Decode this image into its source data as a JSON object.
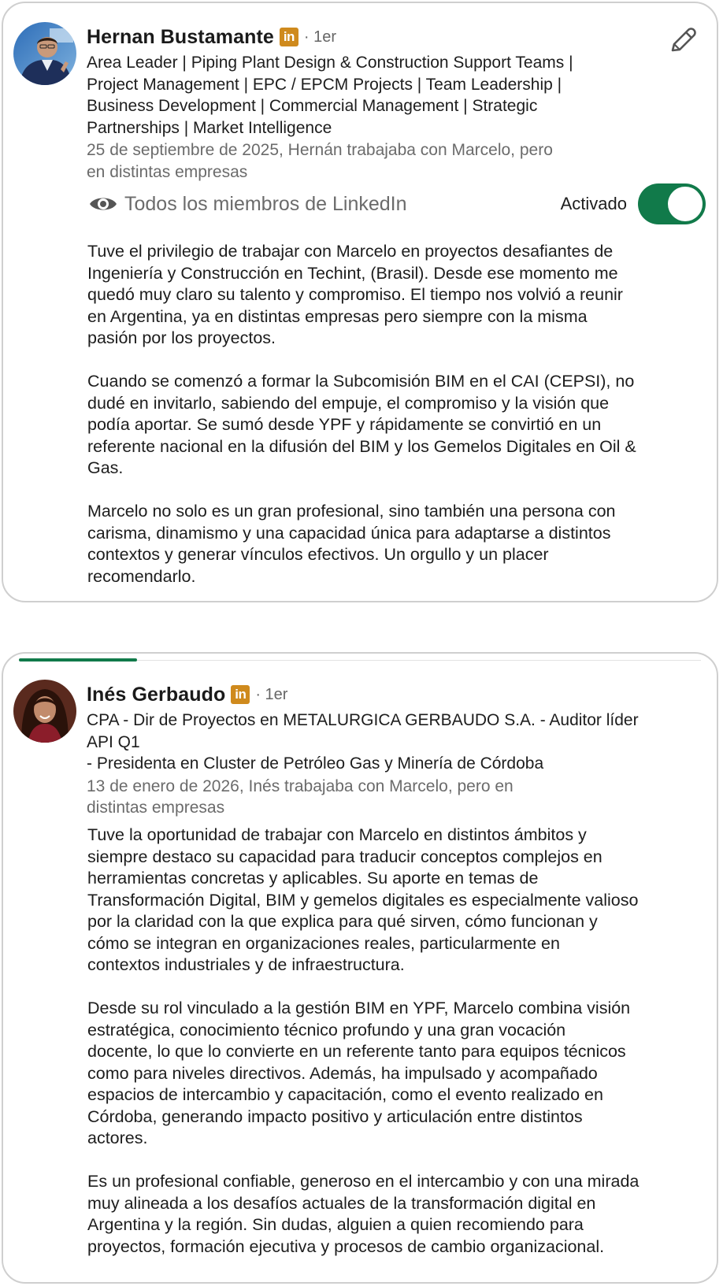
{
  "recommendations": [
    {
      "name": "Hernan Bustamante",
      "degree": "· 1er",
      "headline": "Area Leader | Piping Plant Design & Construction Support Teams |\nProject Management | EPC / EPCM Projects | Team Leadership |\nBusiness Development | Commercial Management | Strategic\nPartnerships | Market Intelligence",
      "meta": "25 de septiembre de 2025, Hernán trabajaba con Marcelo, pero\nen distintas empresas",
      "visibility": "Todos los miembros de LinkedIn",
      "toggle_label": "Activado",
      "paragraphs": [
        "Tuve el privilegio de trabajar con Marcelo en proyectos desafiantes de\nIngeniería y Construcción en Techint, (Brasil). Desde ese momento me\nquedó muy claro su talento y compromiso. El tiempo nos volvió a reunir\nen Argentina, ya en distintas empresas pero siempre con la misma\npasión por los proyectos.",
        "Cuando se comenzó a formar la Subcomisión BIM en el CAI (CEPSI), no\ndudé en invitarlo, sabiendo del empuje, el compromiso y la visión que\npodía aportar. Se sumó desde YPF y rápidamente se convirtió en un\nreferente nacional en la difusión del BIM y los Gemelos Digitales en Oil &\nGas.",
        "Marcelo no solo es un gran profesional, sino también una persona con\ncarisma, dinamismo y una capacidad única para adaptarse a distintos\ncontextos y generar vínculos efectivos. Un orgullo y un placer\nrecomendarlo."
      ]
    },
    {
      "name": "Inés Gerbaudo",
      "degree": "· 1er",
      "headline": "CPA - Dir de Proyectos en METALURGICA GERBAUDO S.A. - Auditor líder\nAPI Q1\n - Presidenta en Cluster de Petróleo Gas y Minería de Córdoba",
      "meta": "13 de enero de 2026, Inés trabajaba con Marcelo, pero en\ndistintas empresas",
      "paragraphs": [
        "Tuve la oportunidad de trabajar con Marcelo en distintos ámbitos y\nsiempre destaco su capacidad para traducir conceptos complejos en\nherramientas concretas y aplicables. Su aporte en temas de\nTransformación Digital, BIM y gemelos digitales es especialmente valioso\npor la claridad con la que explica para qué sirven, cómo funcionan y\ncómo se integran en organizaciones reales, particularmente en\ncontextos industriales y de infraestructura.",
        "Desde su rol vinculado a la gestión BIM en YPF, Marcelo combina visión\nestratégica, conocimiento técnico profundo y una gran vocación\ndocente, lo que lo convierte en un referente tanto para equipos técnicos\ncomo para niveles directivos. Además, ha impulsado y acompañado\nespacios de intercambio y capacitación, como el evento realizado en\nCórdoba, generando impacto positivo y articulación entre distintos\nactores.",
        "Es un profesional confiable, generoso en el intercambio y con una mirada\nmuy alineada a los desafíos actuales de la transformación digital en\nArgentina y la región. Sin dudas, alguien a quien recomiendo para\nproyectos, formación ejecutiva y procesos de cambio organizacional."
      ]
    }
  ],
  "badge_text": "in",
  "icons": {
    "edit": "pencil-icon",
    "visibility": "eye-icon",
    "badge": "linkedin-icon"
  },
  "colors": {
    "linkedin_badge": "#cf8a1d",
    "toggle_on": "#117a4a",
    "tab_indicator": "#117a4a"
  }
}
